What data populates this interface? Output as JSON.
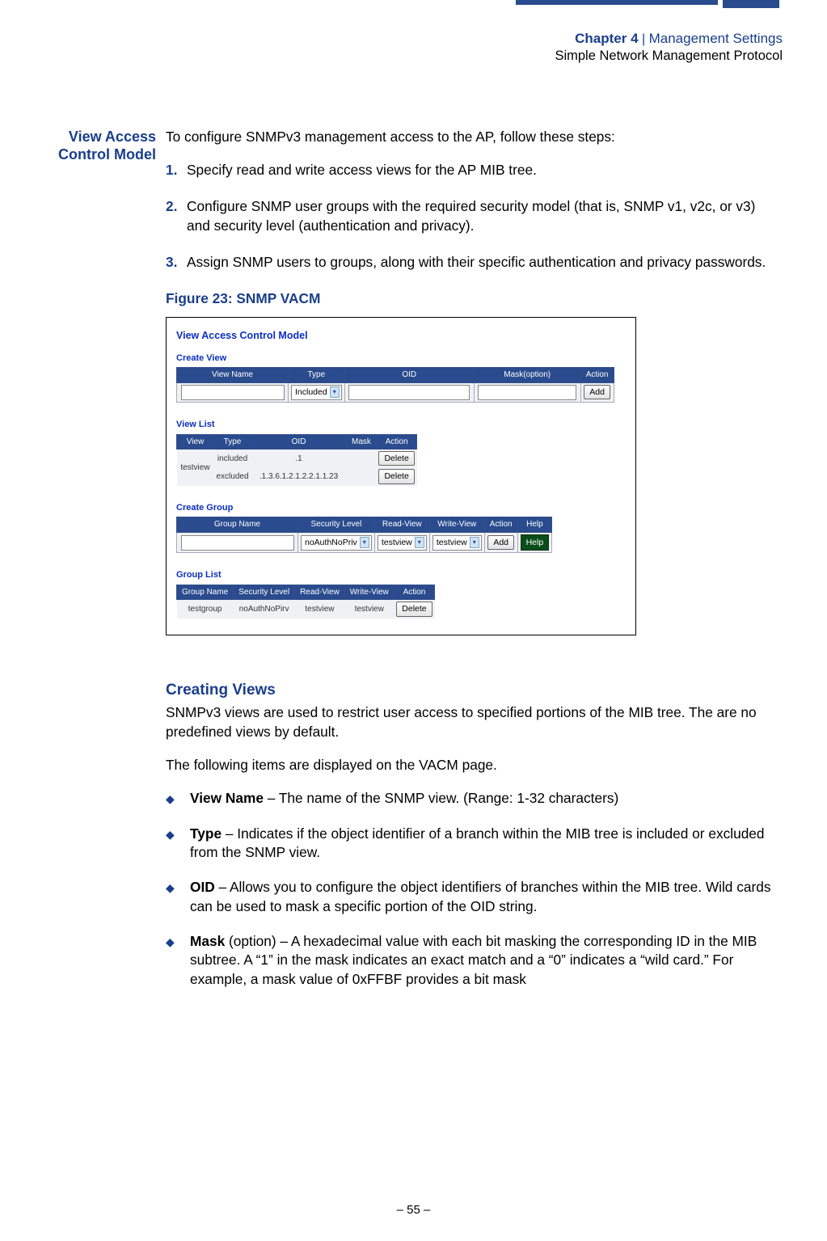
{
  "header": {
    "chapter_label": "Chapter 4",
    "separator": "  |  ",
    "chapter_name": "Management Settings",
    "section_name": "Simple Network Management Protocol"
  },
  "side_heading": "View Access Control Model",
  "intro": "To configure SNMPv3 management access to the AP, follow these steps:",
  "steps": [
    {
      "num": "1.",
      "text": "Specify read and write access views for the AP MIB tree."
    },
    {
      "num": "2.",
      "text": "Configure SNMP user groups with the required security model (that is, SNMP v1, v2c, or v3) and security level (authentication and privacy)."
    },
    {
      "num": "3.",
      "text": "Assign SNMP users to groups, along with their specific authentication and privacy passwords."
    }
  ],
  "figure_caption": "Figure 23:  SNMP VACM",
  "figure": {
    "panel_title": "View Access Control Model",
    "create_view": {
      "title": "Create View",
      "cols": [
        "View Name",
        "Type",
        "OID",
        "Mask(option)",
        "Action"
      ],
      "type_selected": "Included",
      "add_btn": "Add"
    },
    "view_list": {
      "title": "View List",
      "cols": [
        "View",
        "Type",
        "OID",
        "Mask",
        "Action"
      ],
      "rows": [
        {
          "view": "testview",
          "type": "included",
          "oid": ".1",
          "mask": "",
          "action": "Delete"
        },
        {
          "view": "",
          "type": "excluded",
          "oid": ".1.3.6.1.2.1.2.2.1.1.23",
          "mask": "",
          "action": "Delete"
        }
      ]
    },
    "create_group": {
      "title": "Create Group",
      "cols": [
        "Group Name",
        "Security Level",
        "Read-View",
        "Write-View",
        "Action",
        "Help"
      ],
      "sec_level": "noAuthNoPriv",
      "read_view": "testview",
      "write_view": "testview",
      "add_btn": "Add",
      "help_btn": "Help"
    },
    "group_list": {
      "title": "Group List",
      "cols": [
        "Group Name",
        "Security Level",
        "Read-View",
        "Write-View",
        "Action"
      ],
      "rows": [
        {
          "group": "testgroup",
          "sec": "noAuthNoPirv",
          "read": "testview",
          "write": "testview",
          "action": "Delete"
        }
      ]
    }
  },
  "creating_views": {
    "heading": "Creating Views",
    "p1": "SNMPv3 views are used to restrict user access to specified portions of the MIB tree. The are no predefined views by default.",
    "p2": "The following items are displayed on the VACM page.",
    "bullets": [
      {
        "term": "View Name",
        "rest": " – The name of the SNMP view. (Range: 1-32 characters)"
      },
      {
        "term": "Type",
        "rest": " – Indicates if the object identifier of a branch within the MIB tree is included or excluded from the SNMP view."
      },
      {
        "term": "OID",
        "rest": " – Allows you to configure the object identifiers of branches within the MIB tree. Wild cards can be used to mask a specific portion of the OID string."
      },
      {
        "term": "Mask",
        "term2": " (option)",
        "rest": " – A hexadecimal value with each bit masking the corresponding ID in the MIB subtree. A “1” in the mask indicates an exact match and a “0” indicates a “wild card.” For example, a mask value of 0xFFBF provides a bit mask"
      }
    ]
  },
  "footer": "–  55  –"
}
